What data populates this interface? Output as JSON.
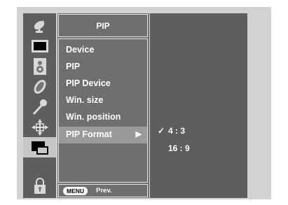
{
  "sidebar": {
    "icons": [
      {
        "name": "satellite-dish-icon"
      },
      {
        "name": "picture-icon"
      },
      {
        "name": "sound-icon"
      },
      {
        "name": "time-icon"
      },
      {
        "name": "special-icon"
      },
      {
        "name": "screen-icon"
      },
      {
        "name": "pip-icon",
        "active": true
      },
      {
        "name": "lock-icon"
      }
    ]
  },
  "menu": {
    "title": "PIP",
    "items": [
      {
        "label": "Device"
      },
      {
        "label": "PIP"
      },
      {
        "label": "PIP Device"
      },
      {
        "label": "Win. size"
      },
      {
        "label": "Win. position"
      },
      {
        "label": "PIP Format",
        "selected": true
      }
    ],
    "selected_arrow": "▶",
    "footer": {
      "menu_label": "MENU",
      "prev_label": "Prev."
    }
  },
  "submenu": {
    "options": [
      {
        "label": "4 : 3",
        "checked": true,
        "check": "✓"
      },
      {
        "label": "16 : 9",
        "checked": false
      }
    ]
  },
  "colors": {
    "frame": "#d2d2d2",
    "sidebar": "#5e5e5e",
    "menu": "#6f6f6f",
    "selected_row": "#9a9a9a"
  }
}
